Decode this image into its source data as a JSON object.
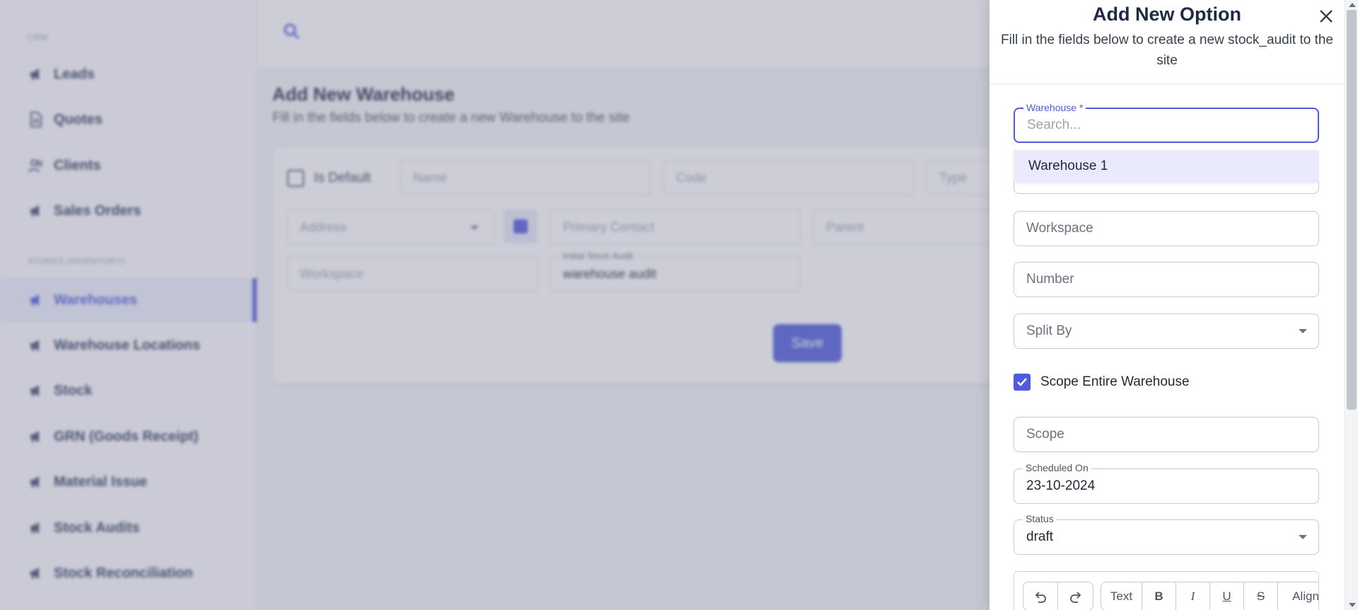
{
  "sidebar": {
    "sections": [
      {
        "label": "CRM"
      },
      {
        "label": "STORES (INVENTORY)"
      }
    ],
    "items": [
      {
        "label": "Leads",
        "icon": "megaphone-icon"
      },
      {
        "label": "Quotes",
        "icon": "document-icon"
      },
      {
        "label": "Clients",
        "icon": "users-icon"
      },
      {
        "label": "Sales Orders",
        "icon": "megaphone-icon"
      },
      {
        "label": "Warehouses",
        "icon": "megaphone-icon",
        "active": true
      },
      {
        "label": "Warehouse Locations",
        "icon": "megaphone-icon"
      },
      {
        "label": "Stock",
        "icon": "megaphone-icon"
      },
      {
        "label": "GRN (Goods Receipt)",
        "icon": "megaphone-icon"
      },
      {
        "label": "Material Issue",
        "icon": "megaphone-icon"
      },
      {
        "label": "Stock Audits",
        "icon": "megaphone-icon"
      },
      {
        "label": "Stock Reconciliation",
        "icon": "megaphone-icon"
      }
    ]
  },
  "background_page": {
    "title": "Add New Warehouse",
    "subtitle": "Fill in the fields below to create a new Warehouse to the site",
    "form": {
      "is_default_label": "Is Default",
      "name_placeholder": "Name",
      "code_placeholder": "Code",
      "type_placeholder": "Type",
      "address_placeholder": "Address",
      "primary_contact_placeholder": "Primary Contact",
      "parent_placeholder": "Parent",
      "workspace_placeholder": "Workspace",
      "initial_stock_audit_label": "Initial Stock Audit",
      "initial_stock_audit_value": "warehouse audit",
      "save_label": "Save"
    }
  },
  "drawer": {
    "title": "Add New Option",
    "subtitle": "Fill in the fields below to create a new stock_audit to the site",
    "warehouse": {
      "label": "Warehouse *",
      "placeholder": "Search...",
      "value": "",
      "options": [
        "Warehouse 1"
      ]
    },
    "workspace_placeholder": "Workspace",
    "number_placeholder": "Number",
    "split_by_placeholder": "Split By",
    "scope_entire_warehouse": {
      "label": "Scope Entire Warehouse",
      "checked": true
    },
    "scope_placeholder": "Scope",
    "scheduled_on": {
      "label": "Scheduled On",
      "value": "23-10-2024"
    },
    "status": {
      "label": "Status",
      "value": "draft"
    },
    "editor_toolbar": {
      "undo_icon": "undo-icon",
      "redo_icon": "redo-icon",
      "text_label": "Text",
      "bold_label": "B",
      "italic_label": "I",
      "underline_label": "U",
      "strike_label": "S",
      "align_label": "Align"
    }
  },
  "colors": {
    "accent": "#4f5bdc",
    "overlay": "rgba(120,124,150,0.38)",
    "dropdown_highlight": "#e9eafb"
  }
}
